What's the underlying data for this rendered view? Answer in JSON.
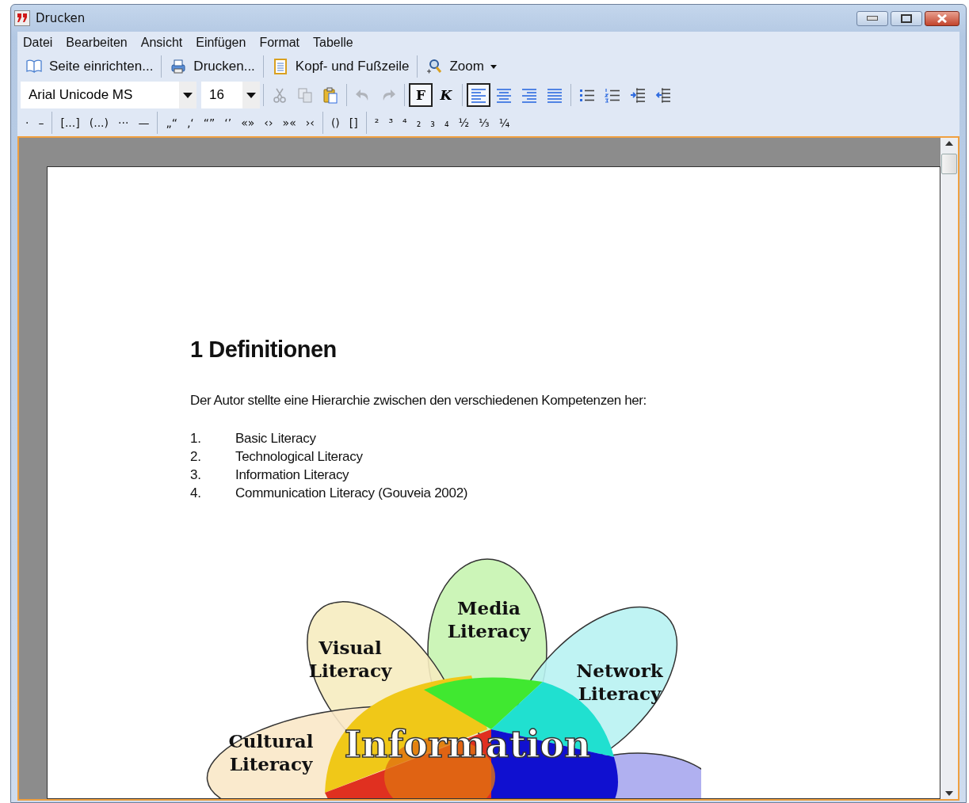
{
  "window": {
    "title": "Drucken"
  },
  "menu": [
    "Datei",
    "Bearbeiten",
    "Ansicht",
    "Einfügen",
    "Format",
    "Tabelle"
  ],
  "toolbar": [
    {
      "kind": "page",
      "label": "Seite einrichten..."
    },
    {
      "kind": "print",
      "label": "Drucken..."
    },
    {
      "kind": "header",
      "label": "Kopf- und Fußzeile"
    },
    {
      "kind": "zoom",
      "label": "Zoom",
      "dropdown": true
    }
  ],
  "format_bar": {
    "font": "Arial Unicode MS",
    "size": "16",
    "tool_groups": [
      [
        {
          "kind": "cut",
          "disabled": true,
          "selected": false
        },
        {
          "kind": "copy",
          "disabled": true,
          "selected": false
        },
        {
          "kind": "paste",
          "disabled": false,
          "selected": false
        }
      ],
      [
        {
          "kind": "undo",
          "disabled": true,
          "selected": false
        },
        {
          "kind": "redo",
          "disabled": true,
          "selected": false
        }
      ],
      [
        {
          "kind": "bold",
          "text": "F",
          "disabled": false,
          "selected": true
        },
        {
          "kind": "italic",
          "text": "K",
          "disabled": false,
          "selected": false
        }
      ],
      [
        {
          "kind": "align-left",
          "disabled": false,
          "selected": true
        },
        {
          "kind": "align-center",
          "disabled": false,
          "selected": false
        },
        {
          "kind": "align-right",
          "disabled": false,
          "selected": false
        },
        {
          "kind": "justify",
          "disabled": false,
          "selected": false
        }
      ],
      [
        {
          "kind": "bullets",
          "disabled": false,
          "selected": false
        },
        {
          "kind": "numbering",
          "disabled": false,
          "selected": false
        },
        {
          "kind": "indent",
          "disabled": false,
          "selected": false
        },
        {
          "kind": "outdent",
          "disabled": false,
          "selected": false
        }
      ]
    ]
  },
  "symbol_bar": [
    [
      "·",
      "–"
    ],
    [
      "[...]",
      "(...)",
      "···",
      "—"
    ],
    [
      "„“",
      "‚‘",
      "“”",
      "‘’",
      "«»",
      "‹›",
      "»«",
      "›‹"
    ],
    [
      "()",
      "[]"
    ],
    [
      "²",
      "³",
      "⁴",
      "₂",
      "₃",
      "₄",
      "½",
      "⅓",
      "¼"
    ]
  ],
  "document": {
    "heading": "1 Definitionen",
    "paragraph": "Der Autor stellte eine Hierarchie zwischen den verschiedenen Kompetenzen her:",
    "list": [
      {
        "number": "1.",
        "text": "Basic Literacy"
      },
      {
        "number": "2.",
        "text": "Technological Literacy"
      },
      {
        "number": "3.",
        "text": "Information Literacy"
      },
      {
        "number": "4.",
        "text": "Communication Literacy (Gouveia 2002)"
      }
    ],
    "diagram": {
      "labels": [
        [
          "Media",
          "Literacy"
        ],
        [
          "Visual",
          "Literacy"
        ],
        [
          "Network",
          "Literacy"
        ],
        [
          "Cultural",
          "Literacy"
        ]
      ],
      "center": "Information"
    }
  }
}
